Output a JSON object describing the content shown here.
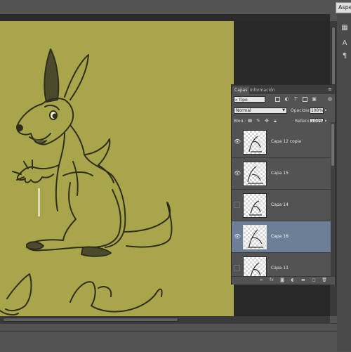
{
  "toolbar": {
    "aspect_label": "Aspecto"
  },
  "right_strip": {
    "icons": [
      "grid-icon",
      "type-icon",
      "paragraph-icon"
    ],
    "glyph_A": "A",
    "glyph_para": "¶"
  },
  "layers_panel": {
    "tabs": [
      {
        "label": "Capas",
        "active": true
      },
      {
        "label": "Información",
        "active": false
      }
    ],
    "filter": {
      "label": "Tipo"
    },
    "blend_mode": "Normal",
    "opacity_label": "Opacidad:",
    "opacity_value": "100%",
    "lock_label": "Bloq.:",
    "fill_label": "Relleno:",
    "fill_value": "100%",
    "layers": [
      {
        "name": "Capa 12 copia",
        "visible": true,
        "selected": false
      },
      {
        "name": "Capa 15",
        "visible": true,
        "selected": false
      },
      {
        "name": "Capa 14",
        "visible": false,
        "selected": false
      },
      {
        "name": "Capa 16",
        "visible": true,
        "selected": true
      },
      {
        "name": "Capa 11",
        "visible": false,
        "selected": false
      }
    ],
    "footer_icons": [
      "link-icon",
      "fx-icon",
      "mask-icon",
      "adjustment-icon",
      "folder-icon",
      "new-layer-icon",
      "trash-icon"
    ],
    "fx_label": "fx"
  },
  "colors": {
    "canvas": "#a8a54a",
    "workspace": "#282828",
    "panel": "#535353",
    "selected_layer": "#6c7f97"
  }
}
